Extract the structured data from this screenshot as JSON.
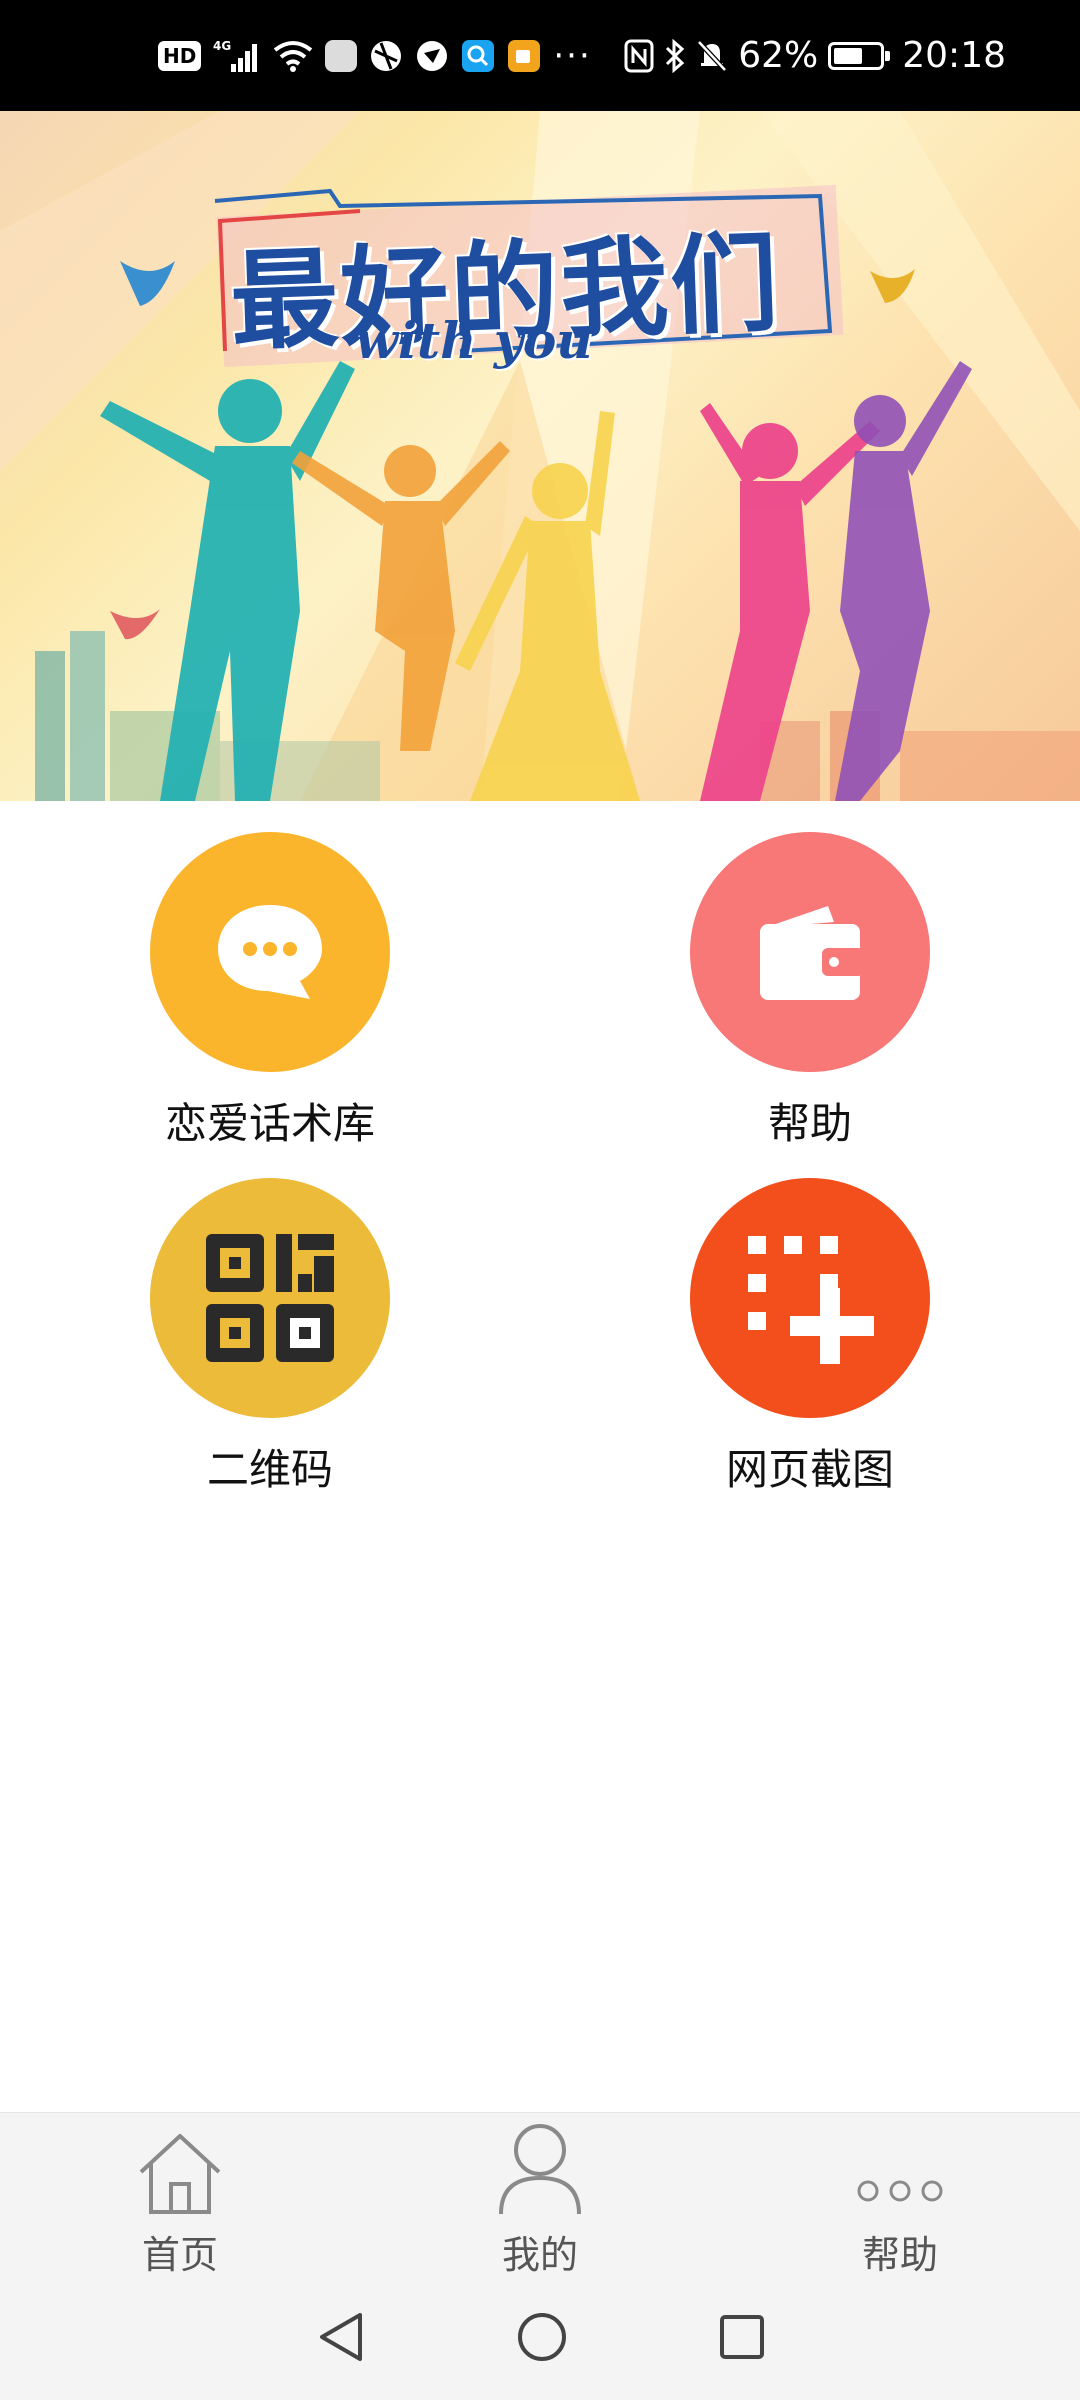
{
  "status_bar": {
    "hd_badge": "HD",
    "network": "4G",
    "battery_percent": "62%",
    "time": "20:18",
    "more": "···",
    "battery_level": 0.62
  },
  "banner": {
    "title": "最好的我们",
    "subtitle": "with you"
  },
  "features": [
    {
      "label": "恋爱话术库",
      "icon": "chat-bubble-icon",
      "color": "#FBB52D"
    },
    {
      "label": "帮助",
      "icon": "wallet-icon",
      "color": "#F87878"
    },
    {
      "label": "二维码",
      "icon": "qr-code-icon",
      "color": "#EDBB3A"
    },
    {
      "label": "网页截图",
      "icon": "screenshot-icon",
      "color": "#F24F1C"
    }
  ],
  "tabs": [
    {
      "label": "首页",
      "icon": "home-icon"
    },
    {
      "label": "我的",
      "icon": "person-icon"
    },
    {
      "label": "帮助",
      "icon": "more-dots-icon"
    }
  ],
  "nav": {
    "back": "back-icon",
    "home": "home-circle-icon",
    "recents": "recents-icon"
  }
}
